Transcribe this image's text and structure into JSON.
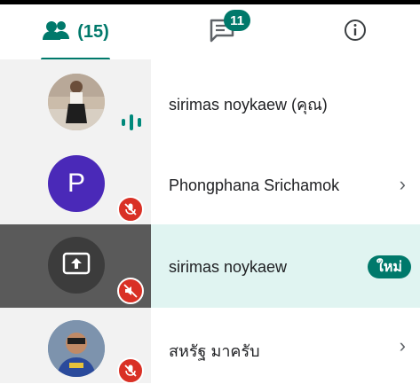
{
  "tabs": {
    "people_count": "(15)",
    "chat_badge": "11"
  },
  "participants": [
    {
      "name": "sirimas noykaew (คุณ)"
    },
    {
      "name": "Phongphana Srichamok",
      "initial": "P"
    },
    {
      "name": "sirimas noykaew",
      "badge": "ใหม่"
    },
    {
      "name": "สหรัฐ มาครับ"
    }
  ],
  "colors": {
    "accent": "#00796b",
    "mic_off": "#d93025",
    "avatar_p": "#4a29b8",
    "highlight_row": "#e0f4f1"
  }
}
